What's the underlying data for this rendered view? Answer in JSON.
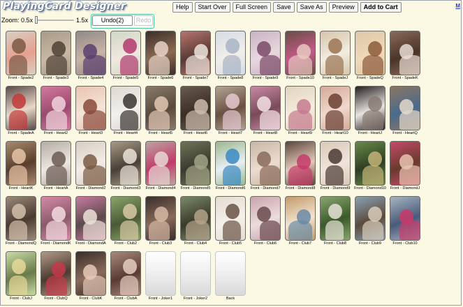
{
  "app": {
    "logo": "PlayingCard Designer",
    "m_link": "M"
  },
  "toolbar": {
    "buttons": [
      {
        "id": "help",
        "label": "Help"
      },
      {
        "id": "start-over",
        "label": "Start Over"
      },
      {
        "id": "full-screen",
        "label": "Full Screen"
      },
      {
        "id": "save",
        "label": "Save"
      },
      {
        "id": "save-as",
        "label": "Save As"
      },
      {
        "id": "preview",
        "label": "Preview"
      },
      {
        "id": "add-to-cart",
        "label": "Add to Cart",
        "bold": true
      }
    ]
  },
  "zoom": {
    "min_label": "Zoom: 0.5x",
    "max_label": "1.5x",
    "level": 0.0
  },
  "history": {
    "undo_label": "Undo(2)",
    "redo_label": "Redo",
    "redo_enabled": false
  },
  "cards": [
    {
      "label": "Front - Spade2",
      "colors": [
        "#d8cfc2",
        "#7a5a44",
        "#e6a090"
      ]
    },
    {
      "label": "Front - Spade3",
      "colors": [
        "#a89a88",
        "#4e4236",
        "#c8b8a4"
      ]
    },
    {
      "label": "Front - Spade4",
      "colors": [
        "#8f8a86",
        "#5a3e6e",
        "#c9b3a6"
      ]
    },
    {
      "label": "Front - Spade5",
      "colors": [
        "#cfd7c4",
        "#b23a6e",
        "#f0e8e0"
      ]
    },
    {
      "label": "Front - Spade6",
      "colors": [
        "#3c2e28",
        "#e8d4c8",
        "#8b6a52"
      ]
    },
    {
      "label": "Front - Spade7",
      "colors": [
        "#b8746e",
        "#ece4de",
        "#5a3a34"
      ]
    },
    {
      "label": "Front - Spade8",
      "colors": [
        "#d4dce4",
        "#a8b4c4",
        "#f2eeea"
      ]
    },
    {
      "label": "Front - Spade9",
      "colors": [
        "#c9b2c2",
        "#7a4a68",
        "#e8d8de"
      ]
    },
    {
      "label": "Front - Spade10",
      "colors": [
        "#6a4e44",
        "#e8c8c0",
        "#c45a8a"
      ]
    },
    {
      "label": "Front - SpadeJ",
      "colors": [
        "#d6c4a8",
        "#9a7452",
        "#f2ece2"
      ]
    },
    {
      "label": "Front - SpadeQ",
      "colors": [
        "#dcc8a6",
        "#8c5a3a",
        "#f0d8b8"
      ]
    },
    {
      "label": "Front - SpadeK",
      "colors": [
        "#8a6a58",
        "#e8ddd4",
        "#4a3428"
      ]
    },
    {
      "label": "Front - SpadeA",
      "colors": [
        "#5a4a48",
        "#c23a3a",
        "#e8d8c8"
      ]
    },
    {
      "label": "Front - Heart2",
      "colors": [
        "#d27a9e",
        "#f0d4dc",
        "#9a4a6e"
      ]
    },
    {
      "label": "Front - Heart3",
      "colors": [
        "#e8c4b0",
        "#8a4a3a",
        "#f4e4d8"
      ]
    },
    {
      "label": "Front - Heart4",
      "colors": [
        "#dcd8d2",
        "#3a3430",
        "#f2f0ec"
      ]
    },
    {
      "label": "Front - Heart5",
      "colors": [
        "#8a7a6a",
        "#e2c8b4",
        "#5a4a3c"
      ]
    },
    {
      "label": "Front - Heart6",
      "colors": [
        "#6a5a4e",
        "#ccbcae",
        "#3a2e26"
      ]
    },
    {
      "label": "Front - Heart7",
      "colors": [
        "#b2a494",
        "#e4c8d0",
        "#6a5040"
      ]
    },
    {
      "label": "Front - Heart8",
      "colors": [
        "#c88aa4",
        "#f2e2e4",
        "#7a4a5a"
      ]
    },
    {
      "label": "Front - Heart9",
      "colors": [
        "#e0d4c0",
        "#c47a8e",
        "#f6ecdc"
      ]
    },
    {
      "label": "Front - Heart10",
      "colors": [
        "#d2aa98",
        "#6a4032",
        "#f0d8cc"
      ]
    },
    {
      "label": "Front - HeartJ",
      "colors": [
        "#242020",
        "#8a7a74",
        "#e8e4e0"
      ]
    },
    {
      "label": "Front - HeartQ",
      "colors": [
        "#8c7664",
        "#e4d8cc",
        "#4a6a8a"
      ]
    },
    {
      "label": "Front - HeartK",
      "colors": [
        "#a88a6e",
        "#e8c4a8",
        "#5a3e2e"
      ]
    },
    {
      "label": "Front - HeartA",
      "colors": [
        "#b4aca4",
        "#6a5a52",
        "#ece6e0"
      ]
    },
    {
      "label": "Front - Diamond2",
      "colors": [
        "#d8cec2",
        "#7a5a44",
        "#f2ece6"
      ]
    },
    {
      "label": "Front - Diamond3",
      "colors": [
        "#a89a86",
        "#eae2d8",
        "#4a4038"
      ]
    },
    {
      "label": "Front - Diamond4",
      "colors": [
        "#bca4a0",
        "#e6d8d4",
        "#c23a6a"
      ]
    },
    {
      "label": "Front - Diamond5",
      "colors": [
        "#6e7456",
        "#a2a286",
        "#3a3a2e"
      ]
    },
    {
      "label": "Front - Diamond6",
      "colors": [
        "#9ab88e",
        "#3a8ac4",
        "#e8eef4"
      ]
    },
    {
      "label": "Front - Diamond7",
      "colors": [
        "#c8b6a4",
        "#8a6a5a",
        "#ecdcd0"
      ]
    },
    {
      "label": "Front - Diamond8",
      "colors": [
        "#5a463c",
        "#c43a6a",
        "#e4c8b8"
      ]
    },
    {
      "label": "Front - Diamond9",
      "colors": [
        "#d8c8b8",
        "#4a3a34",
        "#f0e4da"
      ]
    },
    {
      "label": "Front - Diamond10",
      "colors": [
        "#6a8a4a",
        "#c4b478",
        "#2e3e22"
      ]
    },
    {
      "label": "Front - DiamondJ",
      "colors": [
        "#c44a6a",
        "#e8c4b0",
        "#6a3a2e"
      ]
    },
    {
      "label": "Front - DiamondQ",
      "colors": [
        "#9a8a7a",
        "#d4c0ac",
        "#4a3a30"
      ]
    },
    {
      "label": "Front - DiamondK",
      "colors": [
        "#d68aa8",
        "#f2dce0",
        "#8a5a6a"
      ]
    },
    {
      "label": "Front - DiamondA",
      "colors": [
        "#c87aa0",
        "#ece0d8",
        "#5a4a4a"
      ]
    },
    {
      "label": "Front - Club2",
      "colors": [
        "#8aa46a",
        "#d8c8a4",
        "#4a5a36"
      ]
    },
    {
      "label": "Front - Club3",
      "colors": [
        "#3a2e2a",
        "#d6b8a4",
        "#8a6a5a"
      ]
    },
    {
      "label": "Front - Club4",
      "colors": [
        "#7a8a6a",
        "#b4a28a",
        "#3a3a2a"
      ]
    },
    {
      "label": "Front - Club5",
      "colors": [
        "#e4dcd0",
        "#6a5444",
        "#f4f0ea"
      ]
    },
    {
      "label": "Front - Club6",
      "colors": [
        "#c8a4ac",
        "#6a4a4e",
        "#ecdcdc"
      ]
    },
    {
      "label": "Front - Club7",
      "colors": [
        "#c49a6a",
        "#6a8aa4",
        "#f0e4d0"
      ]
    },
    {
      "label": "Front - Club8",
      "colors": [
        "#8aa46e",
        "#e8e2d8",
        "#3a5a2a"
      ]
    },
    {
      "label": "Front - Club9",
      "colors": [
        "#8aa0b4",
        "#d8ccb8",
        "#5a4a3a"
      ]
    },
    {
      "label": "Front - Club10",
      "colors": [
        "#a6b4c0",
        "#c83a6a",
        "#4a5a7a"
      ]
    },
    {
      "label": "Front - ClubJ",
      "colors": [
        "#c8dca4",
        "#e8d89a",
        "#6a7a4a"
      ]
    },
    {
      "label": "Front - ClubQ",
      "colors": [
        "#b49a86",
        "#c43a4a",
        "#4a3a30"
      ]
    },
    {
      "label": "Front - ClubK",
      "colors": [
        "#3a2e2a",
        "#e6c8b8",
        "#8a6a5a"
      ]
    },
    {
      "label": "Front - ClubA",
      "colors": [
        "#a88a7a",
        "#e4ccc0",
        "#5a3a34"
      ]
    },
    {
      "label": "Front - Joker1",
      "blank": true
    },
    {
      "label": "Front - Joker2",
      "blank": true
    },
    {
      "label": "Back",
      "blank": true
    }
  ]
}
